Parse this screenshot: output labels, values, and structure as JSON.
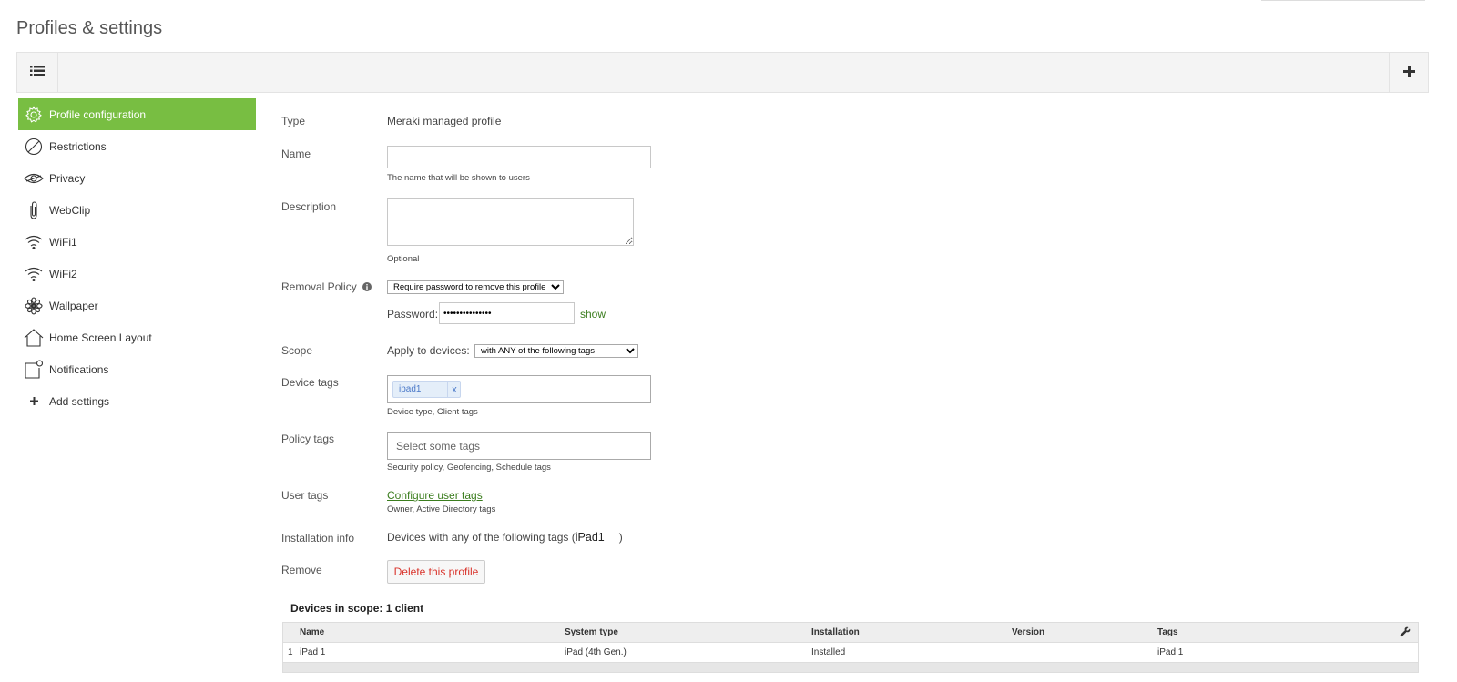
{
  "page": {
    "title": "Profiles & settings"
  },
  "sidebar": {
    "items": [
      {
        "label": "Profile configuration",
        "icon": "gear-icon",
        "active": true
      },
      {
        "label": "Restrictions",
        "icon": "no-entry-icon"
      },
      {
        "label": "Privacy",
        "icon": "eye-icon"
      },
      {
        "label": "WebClip",
        "icon": "paperclip-icon"
      },
      {
        "label": "WiFi1",
        "icon": "wifi-icon"
      },
      {
        "label": "WiFi2",
        "icon": "wifi-icon"
      },
      {
        "label": "Wallpaper",
        "icon": "flower-icon"
      },
      {
        "label": "Home Screen Layout",
        "icon": "home-icon"
      },
      {
        "label": "Notifications",
        "icon": "notification-icon"
      },
      {
        "label": "Add settings",
        "icon": "plus-icon"
      }
    ],
    "active_color": "#78be42"
  },
  "form": {
    "type": {
      "label": "Type",
      "value": "Meraki managed profile"
    },
    "name": {
      "label": "Name",
      "value": "",
      "hint": "The name that will be shown to users"
    },
    "description": {
      "label": "Description",
      "value": "",
      "hint": "Optional"
    },
    "removal_policy": {
      "label": "Removal Policy",
      "selected": "Require password to remove this profile",
      "password_label": "Password:",
      "password_value": "•••••••••••••••",
      "show_link": "show"
    },
    "scope": {
      "label": "Scope",
      "apply_label": "Apply to devices:",
      "selected": "with ANY of the following tags"
    },
    "device_tags": {
      "label": "Device tags",
      "chip": "ipad1",
      "chip_remove": "x",
      "hint": "Device type, Client tags"
    },
    "policy_tags": {
      "label": "Policy tags",
      "placeholder": "Select some tags",
      "hint": "Security policy, Geofencing, Schedule tags"
    },
    "user_tags": {
      "label": "User tags",
      "link": "Configure user tags",
      "hint": "Owner, Active Directory tags"
    },
    "installation_info": {
      "label": "Installation info",
      "prefix": "Devices with any of the following tags (",
      "tag": "iPad1",
      "suffix": ")"
    },
    "remove": {
      "label": "Remove",
      "button": "Delete this profile"
    }
  },
  "devices": {
    "title": "Devices in scope: 1 client",
    "columns": [
      "Name",
      "System type",
      "Installation",
      "Version",
      "Tags"
    ],
    "rows": [
      {
        "index": "1",
        "name": "iPad 1",
        "system_type": "iPad (4th Gen.)",
        "installation": "Installed",
        "version": "",
        "tags": "iPad 1"
      }
    ]
  }
}
